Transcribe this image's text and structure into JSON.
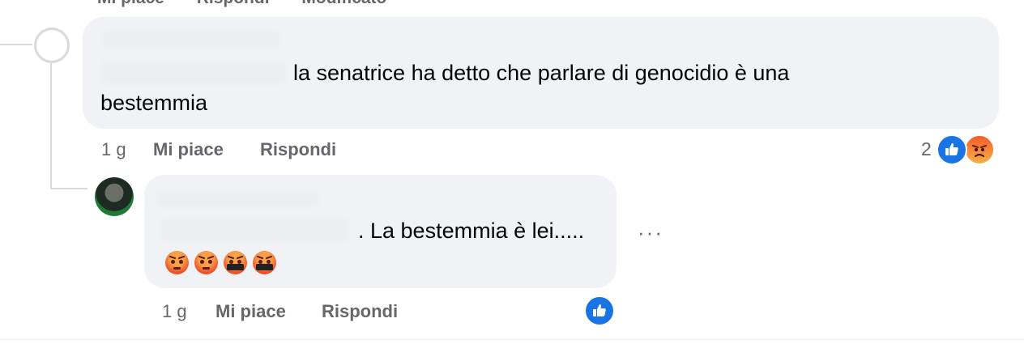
{
  "top_clipped_actions": [
    "Mi piace",
    "Rispondi",
    "Modificato"
  ],
  "comments": [
    {
      "text_line1": "la senatrice ha detto che parlare di genocidio è una",
      "text_line2": "bestemmia",
      "time": "1 g",
      "like_label": "Mi piace",
      "reply_label": "Rispondi",
      "reaction_count": "2",
      "reactions": [
        "like-icon",
        "angry-icon"
      ]
    },
    {
      "text": ". La bestemmia è lei.....",
      "emojis": [
        "angry-face",
        "angry-face",
        "cursing-face",
        "cursing-face"
      ],
      "time": "1 g",
      "like_label": "Mi piace",
      "reply_label": "Rispondi",
      "more_label": "···",
      "reactions": [
        "like-icon"
      ]
    }
  ],
  "colors": {
    "bubble_bg": "#f0f2f5",
    "meta_text": "#65676b",
    "like_blue": "#1b74e4",
    "thread_line": "#d8dadf"
  }
}
